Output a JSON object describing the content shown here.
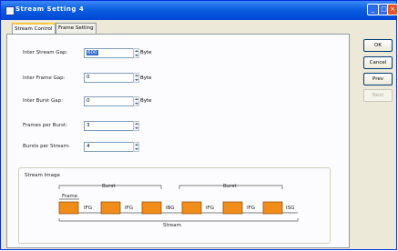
{
  "window": {
    "title": "Stream Setting 4"
  },
  "tabs": [
    {
      "label": "Stream Control"
    },
    {
      "label": "Frame Setting"
    }
  ],
  "fields": {
    "inter_stream_gap": {
      "label": "Inter Stream Gap:",
      "value": "600",
      "unit": "Byte"
    },
    "inter_frame_gap": {
      "label": "Inter Frame Gap:",
      "value": "0",
      "unit": "Byte"
    },
    "inter_burst_gap": {
      "label": "Inter Burst Gap:",
      "value": "0",
      "unit": "Byte"
    },
    "frames_per_burst": {
      "label": "Frames per Burst:",
      "value": "3"
    },
    "bursts_per_stream": {
      "label": "Bursts per Stream:",
      "value": "4"
    }
  },
  "stream_image": {
    "title": "Stream Image",
    "frame_label": "Frame",
    "burst_label": "Burst",
    "ifg_label": "IFG",
    "ibg_label": "IBG",
    "isg_label": "ISG",
    "stream_label": "Stream"
  },
  "buttons": {
    "ok": "OK",
    "cancel": "Cancel",
    "prev": "Prev",
    "next": "Next"
  },
  "colors": {
    "frame_block": "#f08c1a",
    "title_bar": "#0a5fe0",
    "selection": "#316ac5"
  }
}
